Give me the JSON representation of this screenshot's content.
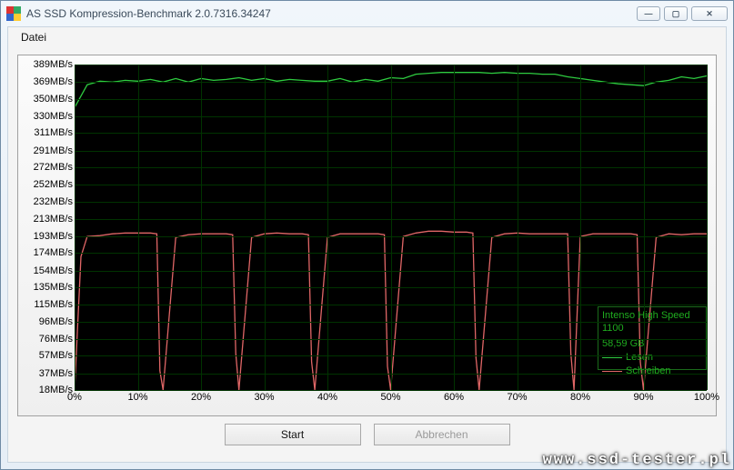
{
  "window": {
    "title": "AS SSD Kompression-Benchmark 2.0.7316.34247"
  },
  "menu": {
    "file": "Datei"
  },
  "buttons": {
    "start": "Start",
    "abort": "Abbrechen"
  },
  "legend": {
    "device": "Intenso High Speed",
    "model": "1100",
    "capacity": "58,59 GB",
    "read": "Lesen",
    "write": "Schreiben"
  },
  "watermark": "www.ssd-tester.pl",
  "chart_data": {
    "type": "line",
    "xlabel": "",
    "ylabel": "",
    "xlim": [
      0,
      100
    ],
    "ylim": [
      18,
      389
    ],
    "y_ticks": [
      389,
      369,
      350,
      330,
      311,
      291,
      272,
      252,
      232,
      213,
      193,
      174,
      154,
      135,
      115,
      96,
      76,
      57,
      37,
      18
    ],
    "y_tick_fmt": "{v}MB/s",
    "x_ticks": [
      0,
      10,
      20,
      30,
      40,
      50,
      60,
      70,
      80,
      90,
      100
    ],
    "x_tick_fmt": "{v}%",
    "series": [
      {
        "name": "Lesen",
        "color": "#2ecc40",
        "x": [
          0,
          2,
          4,
          6,
          8,
          10,
          12,
          14,
          16,
          18,
          20,
          22,
          24,
          26,
          28,
          30,
          32,
          34,
          36,
          38,
          40,
          42,
          44,
          46,
          48,
          50,
          52,
          54,
          56,
          58,
          60,
          62,
          64,
          66,
          68,
          70,
          72,
          74,
          76,
          78,
          80,
          82,
          84,
          86,
          88,
          90,
          92,
          94,
          96,
          98,
          100
        ],
        "y": [
          340,
          366,
          370,
          369,
          371,
          370,
          372,
          369,
          373,
          369,
          373,
          371,
          372,
          374,
          371,
          373,
          370,
          372,
          371,
          370,
          370,
          373,
          369,
          372,
          370,
          374,
          373,
          378,
          379,
          380,
          380,
          380,
          380,
          379,
          380,
          379,
          379,
          378,
          378,
          375,
          373,
          371,
          369,
          367,
          366,
          365,
          369,
          371,
          375,
          373,
          376
        ]
      },
      {
        "name": "Schreiben",
        "color": "#e06666",
        "x": [
          0,
          1,
          2,
          4,
          6,
          8,
          10,
          12,
          13,
          13.5,
          14,
          16,
          18,
          20,
          22,
          24,
          25,
          25.5,
          26,
          28,
          30,
          32,
          34,
          36,
          37,
          37.5,
          38,
          40,
          42,
          44,
          46,
          48,
          49,
          49.5,
          50,
          52,
          54,
          56,
          58,
          60,
          62,
          63,
          63.5,
          64,
          66,
          68,
          70,
          72,
          74,
          76,
          78,
          78.5,
          79,
          80,
          82,
          84,
          86,
          88,
          89,
          89.5,
          90,
          92,
          94,
          96,
          98,
          100
        ],
        "y": [
          18,
          170,
          193,
          194,
          196,
          197,
          197,
          197,
          196,
          40,
          18,
          192,
          195,
          196,
          196,
          196,
          195,
          60,
          18,
          192,
          196,
          197,
          196,
          196,
          195,
          50,
          18,
          192,
          196,
          196,
          196,
          196,
          195,
          45,
          18,
          193,
          197,
          199,
          199,
          198,
          198,
          197,
          55,
          18,
          192,
          196,
          197,
          196,
          196,
          196,
          196,
          60,
          18,
          193,
          196,
          196,
          196,
          196,
          195,
          50,
          18,
          192,
          196,
          195,
          196,
          196
        ]
      }
    ]
  }
}
